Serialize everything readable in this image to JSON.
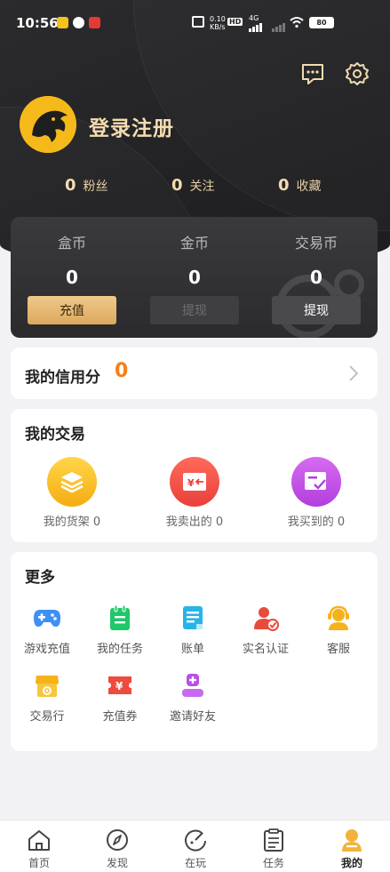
{
  "status_bar": {
    "time": "10:56",
    "net_speed_top": "0.10",
    "net_speed_bottom": "KB/s",
    "hd": "HD",
    "signal": "4G",
    "battery": "80"
  },
  "header": {
    "message_icon": "message-icon",
    "settings_icon": "gear-icon"
  },
  "profile": {
    "login_text": "登录注册",
    "avatar_icon": "dragon-logo"
  },
  "stats": [
    {
      "value": "0",
      "label": "粉丝"
    },
    {
      "value": "0",
      "label": "关注"
    },
    {
      "value": "0",
      "label": "收藏"
    }
  ],
  "wallet": [
    {
      "name": "盒币",
      "value": "0",
      "button": "充值"
    },
    {
      "name": "金币",
      "value": "0",
      "button": "提现"
    },
    {
      "name": "交易币",
      "value": "0",
      "button": "提现"
    }
  ],
  "credit": {
    "title": "我的信用分",
    "value": "0"
  },
  "trades": {
    "title": "我的交易",
    "items": [
      {
        "label": "我的货架 0",
        "icon": "layers-icon"
      },
      {
        "label": "我卖出的 0",
        "icon": "yuan-outgoing-icon"
      },
      {
        "label": "我买到的 0",
        "icon": "card-check-icon"
      }
    ]
  },
  "more": {
    "title": "更多",
    "items": [
      {
        "label": "游戏充值",
        "icon": "gamepad-icon"
      },
      {
        "label": "我的任务",
        "icon": "task-clipboard-icon"
      },
      {
        "label": "账单",
        "icon": "bill-icon"
      },
      {
        "label": "实名认证",
        "icon": "user-verified-icon"
      },
      {
        "label": "客服",
        "icon": "customer-service-icon"
      },
      {
        "label": "交易行",
        "icon": "shop-icon"
      },
      {
        "label": "充值券",
        "icon": "coupon-icon"
      },
      {
        "label": "邀请好友",
        "icon": "invite-user-icon"
      }
    ]
  },
  "tabbar": [
    {
      "label": "首页",
      "icon": "home-icon"
    },
    {
      "label": "发现",
      "icon": "compass-icon"
    },
    {
      "label": "在玩",
      "icon": "playing-icon"
    },
    {
      "label": "任务",
      "icon": "tasks-list-icon"
    },
    {
      "label": "我的",
      "icon": "profile-icon",
      "active": true
    }
  ],
  "colors": {
    "accent_gold": "#e8b865",
    "credit_orange": "#f57f17",
    "dark_header": "#262628"
  }
}
